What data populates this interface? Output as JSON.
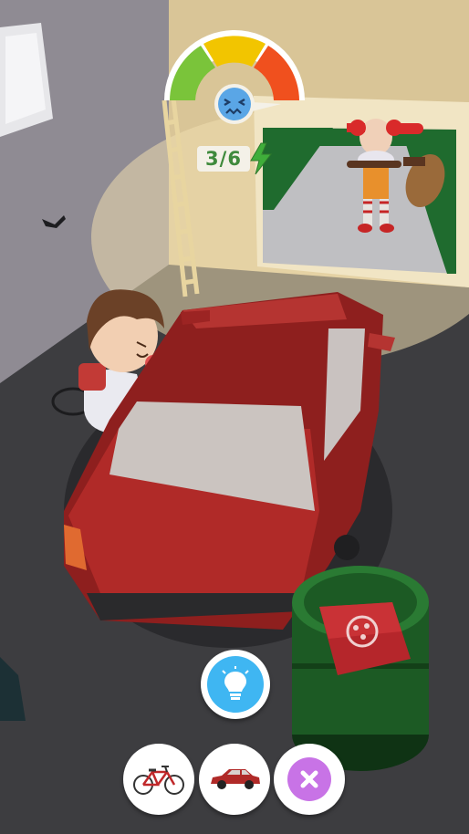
{
  "hud": {
    "energy_counter": "3/6",
    "fear_meter_icon": "scared-face-icon",
    "energy_icon": "lightning-icon"
  },
  "colors": {
    "meter_green": "#7ac43a",
    "meter_yellow": "#f2c500",
    "meter_red": "#f0501e",
    "counter_text": "#3f8a3c",
    "hint_blue": "#3fb6f2",
    "cancel_purple": "#c873e6",
    "car_red": "#a52826"
  },
  "actions": [
    {
      "name": "hint",
      "icon": "lightbulb-icon"
    },
    {
      "name": "bicycle",
      "icon": "bicycle-icon"
    },
    {
      "name": "car",
      "icon": "car-icon"
    },
    {
      "name": "cancel",
      "icon": "close-icon"
    }
  ]
}
